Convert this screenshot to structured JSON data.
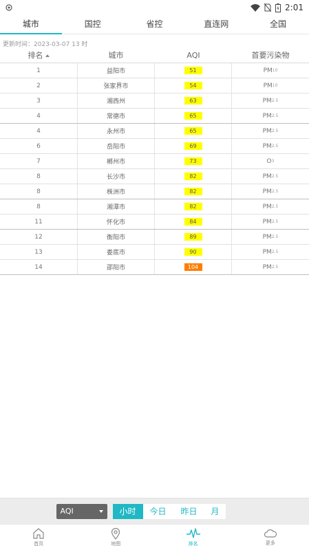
{
  "status": {
    "time": "2:01"
  },
  "tabs": [
    {
      "label": "城市",
      "active": true
    },
    {
      "label": "国控",
      "active": false
    },
    {
      "label": "省控",
      "active": false
    },
    {
      "label": "直连网",
      "active": false
    },
    {
      "label": "全国",
      "active": false
    }
  ],
  "update_time": "更新时间：2023-03-07 13 时",
  "table": {
    "headers": {
      "rank": "排名",
      "city": "城市",
      "aqi": "AQI",
      "pollutant": "首要污染物"
    },
    "rows": [
      {
        "rank": "1",
        "city": "益阳市",
        "aqi": "51",
        "pol": "PM",
        "sub": "10"
      },
      {
        "rank": "2",
        "city": "张家界市",
        "aqi": "54",
        "pol": "PM",
        "sub": "10"
      },
      {
        "rank": "3",
        "city": "湘西州",
        "aqi": "63",
        "pol": "PM",
        "sub": "2.5"
      },
      {
        "rank": "4",
        "city": "常德市",
        "aqi": "65",
        "pol": "PM",
        "sub": "2.5"
      },
      {
        "rank": "4",
        "city": "永州市",
        "aqi": "65",
        "pol": "PM",
        "sub": "2.5"
      },
      {
        "rank": "6",
        "city": "岳阳市",
        "aqi": "69",
        "pol": "PM",
        "sub": "2.5"
      },
      {
        "rank": "7",
        "city": "郴州市",
        "aqi": "73",
        "pol": "O",
        "sub": "3"
      },
      {
        "rank": "8",
        "city": "长沙市",
        "aqi": "82",
        "pol": "PM",
        "sub": "2.5"
      },
      {
        "rank": "8",
        "city": "株洲市",
        "aqi": "82",
        "pol": "PM",
        "sub": "2.5"
      },
      {
        "rank": "8",
        "city": "湘潭市",
        "aqi": "82",
        "pol": "PM",
        "sub": "2.5"
      },
      {
        "rank": "11",
        "city": "怀化市",
        "aqi": "84",
        "pol": "PM",
        "sub": "2.5"
      },
      {
        "rank": "12",
        "city": "衡阳市",
        "aqi": "89",
        "pol": "PM",
        "sub": "2.5"
      },
      {
        "rank": "13",
        "city": "娄底市",
        "aqi": "90",
        "pol": "PM",
        "sub": "2.5"
      },
      {
        "rank": "14",
        "city": "邵阳市",
        "aqi": "104",
        "pol": "PM",
        "sub": "2.5"
      }
    ]
  },
  "colors": {
    "accent": "#1fb8c4",
    "aqi_moderate": "#ffff00",
    "aqi_sensitive": "#ff7e00"
  },
  "filter": {
    "select_value": "AQI",
    "periods": [
      {
        "label": "小时",
        "active": true
      },
      {
        "label": "今日",
        "active": false
      },
      {
        "label": "昨日",
        "active": false
      },
      {
        "label": "月",
        "active": false
      }
    ]
  },
  "bottom_nav": [
    {
      "label": "首页",
      "icon": "home-icon"
    },
    {
      "label": "地图",
      "icon": "map-pin-icon"
    },
    {
      "label": "排名",
      "icon": "pulse-icon",
      "active": true
    },
    {
      "label": "更多",
      "icon": "cloud-icon"
    }
  ]
}
